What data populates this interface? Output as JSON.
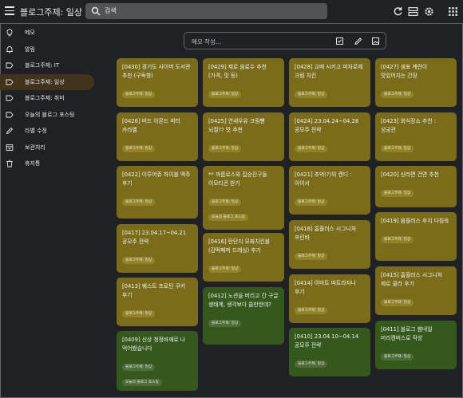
{
  "header": {
    "title": "블로그주제: 일상",
    "search_placeholder": "검색",
    "icons": [
      "menu-icon",
      "search-icon",
      "refresh-icon",
      "list-view-icon",
      "settings-icon",
      "apps-icon"
    ]
  },
  "sidebar": {
    "items": [
      {
        "label": "메모",
        "icon": "lightbulb-icon",
        "active": false
      },
      {
        "label": "알림",
        "icon": "bell-icon",
        "active": false
      },
      {
        "label": "블로그주제: IT",
        "icon": "label-icon",
        "active": false
      },
      {
        "label": "블로그주제: 일상",
        "icon": "label-icon",
        "active": true
      },
      {
        "label": "블로그주제: 취미",
        "icon": "label-icon",
        "active": false
      },
      {
        "label": "오늘의 블로그 포스팅",
        "icon": "label-icon",
        "active": false
      },
      {
        "label": "라벨 수정",
        "icon": "pencil-icon",
        "active": false
      },
      {
        "label": "보관처리",
        "icon": "archive-icon",
        "active": false
      },
      {
        "label": "휴지통",
        "icon": "trash-icon",
        "active": false
      }
    ]
  },
  "note_input": {
    "placeholder": "메모 작성...",
    "icons": [
      "checkbox-icon",
      "brush-icon",
      "image-icon"
    ]
  },
  "cards": [
    {
      "title": "[0430] 경기도 사이버 도서관 추천 (구독형)",
      "tags": [
        "블로그주제: 일상"
      ],
      "color": "#7b6c1c"
    },
    {
      "title": "[0429] 제로 음료수 추천 (가격, 맛 등)",
      "tags": [
        "블로그주제: 일상"
      ],
      "color": "#7b6c1c"
    },
    {
      "title": "[0428] 교배 시키고 피자로제 크림 치킨",
      "tags": [
        "블로그주제: 일상"
      ],
      "color": "#7b6c1c"
    },
    {
      "title": "[0427] 샘표 계란이 맛있어지는 간장",
      "tags": [
        "블로그주제: 일상"
      ],
      "color": "#7b6c1c"
    },
    {
      "title": "[0426] 버드 아몬드 버터 카라멜",
      "tags": [
        "블로그주제: 일상"
      ],
      "color": "#7b6c1c"
    },
    {
      "title": "[0425] 연세우유 크림빵 뇌절?? 맛 추천",
      "tags": [
        "블로그주제: 일상"
      ],
      "color": "#7b6c1c"
    },
    {
      "title": "[0424] 23.04.24~04.28 공모주 전략",
      "tags": [
        "블로그주제: 일상"
      ],
      "color": "#7b6c1c"
    },
    {
      "title": "[0423] 회식장소 추천 : 성궁관",
      "tags": [
        "블로그주제: 일상"
      ],
      "color": "#7b6c1c"
    },
    {
      "title": "[0422] 이루어쥬 하이볼 맥주 후기",
      "tags": [
        "블로그주제: 일상"
      ],
      "color": "#7b6c1c"
    },
    {
      "title": "** 까름로스와 집승진구들 이모티콘 받기",
      "tags": [
        "블로그주제: 일상",
        "오늘의 블로그 포스팅"
      ],
      "color": "#7b6c1c"
    },
    {
      "title": "[0421] 추억(?)의 캔디 : 아이서",
      "tags": [
        "블로그주제: 일상"
      ],
      "color": "#7b6c1c"
    },
    {
      "title": "[0420] 신라면 건면 추천",
      "tags": [
        "블로그주제: 일상"
      ],
      "color": "#7b6c1c"
    },
    {
      "title": "[0419] 움플러스 후지 다짐육",
      "tags": [
        "블로그주제: 일상"
      ],
      "color": "#7b6c1c"
    },
    {
      "title": "[0417] 23.04.17~04.21 공모주 전략",
      "tags": [
        "블로그주제: 일상"
      ],
      "color": "#7b6c1c"
    },
    {
      "title": "[0418] 홈플러스 시그니처 프린바",
      "tags": [
        "블로그주제: 일상"
      ],
      "color": "#7b6c1c"
    },
    {
      "title": "[0416] 탄단지 모짜치킨볼 (감떡페퍼 드레싱) 후기",
      "tags": [
        "블로그주제: 일상"
      ],
      "color": "#7b6c1c"
    },
    {
      "title": "[0415] 홈플러스 시그니처 제로 콜라 후기",
      "tags": [
        "블로그주제: 일상"
      ],
      "color": "#7b6c1c"
    },
    {
      "title": "[0413] 퀘스트 프로틴 쿠키 후기",
      "tags": [
        "블로그주제: 일상"
      ],
      "color": "#7b6c1c"
    },
    {
      "title": "[0414] 이마트 떠트라자나 후기",
      "tags": [
        "블로그주제: 일상"
      ],
      "color": "#7b6c1c"
    },
    {
      "title": "[0412] 노션을 버리고 간 구글 생태계, 생각보다 쓸만한데?",
      "tags": [
        "블로그주제: 일상"
      ],
      "color": "#35581d"
    },
    {
      "title": "[0411] 블로그 썸네일 머리캔버스로 작성",
      "tags": [
        "블로그주제: 일상"
      ],
      "color": "#35581d"
    },
    {
      "title": "[0409] 신상 청정바께로 나 먹어봤습니다",
      "tags": [
        "블로그주제: 일상",
        "오늘의 블로그 포스팅"
      ],
      "color": "#35581d"
    },
    {
      "title": "[0410] 23.04.10~04.14 공모주 전략",
      "tags": [
        "블로그주제: 일상"
      ],
      "color": "#35581d"
    }
  ]
}
